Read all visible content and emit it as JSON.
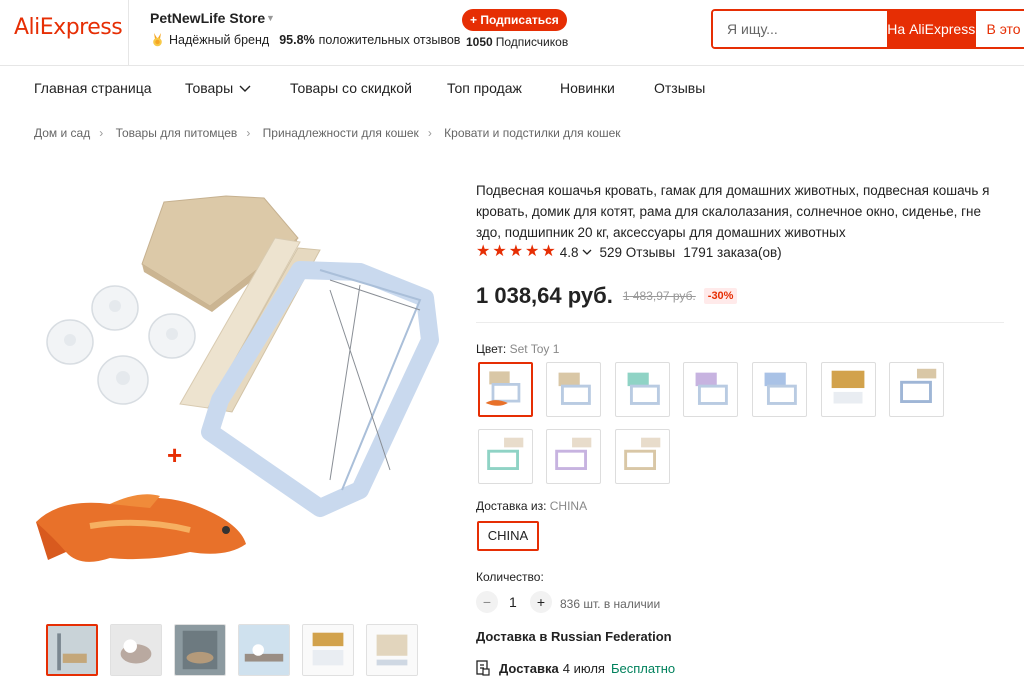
{
  "header": {
    "logo": "AliExpress",
    "store_name": "PetNewLife Store",
    "brand_label": "Надёжный бренд",
    "positive_pct": "95.8%",
    "positive_label": "положительных отзывов",
    "subscribe_label": "+ Подписаться",
    "subscribers_count": "1050",
    "subscribers_label": "Подписчиков",
    "search_placeholder": "Я ищу...",
    "search_btn": "На AliExpress",
    "search_btn2": "В это"
  },
  "nav": {
    "items": [
      "Главная страница",
      "Товары",
      "Товары со скидкой",
      "Топ продаж",
      "Новинки",
      "Отзывы"
    ]
  },
  "breadcrumbs": [
    "Дом и сад",
    "Товары для питомцев",
    "Принадлежности для кошек",
    "Кровати и подстилки для кошек"
  ],
  "product": {
    "title": "Подвесная кошачья кровать, гамак для домашних животных, подвесная кошачь я кровать, домик для котят, рама для скалолазания, солнечное окно, сиденье, гне здо, подшипник 20 кг, аксессуары для домашних животных",
    "rating": "4.8",
    "reviews": "529 Отзывы",
    "orders": "1791 заказа(ов)",
    "price": "1 038,64 руб.",
    "old_price": "1 483,97 руб.",
    "discount": "-30%",
    "color_label": "Цвет:",
    "color_value": "Set Toy 1",
    "ship_from_label": "Доставка из:",
    "ship_from_value": "CHINA",
    "ship_from_option": "CHINA",
    "quantity_label": "Количество:",
    "quantity": "1",
    "minus": "−",
    "plus": "+",
    "stock": "836 шт. в наличии",
    "delivery_title": "Доставка в Russian Federation",
    "delivery_label": "Доставка",
    "delivery_date": "4 июля",
    "delivery_cost": "Бесплатно"
  },
  "colors": {
    "accent": "#e62e04",
    "free": "#00815c"
  }
}
